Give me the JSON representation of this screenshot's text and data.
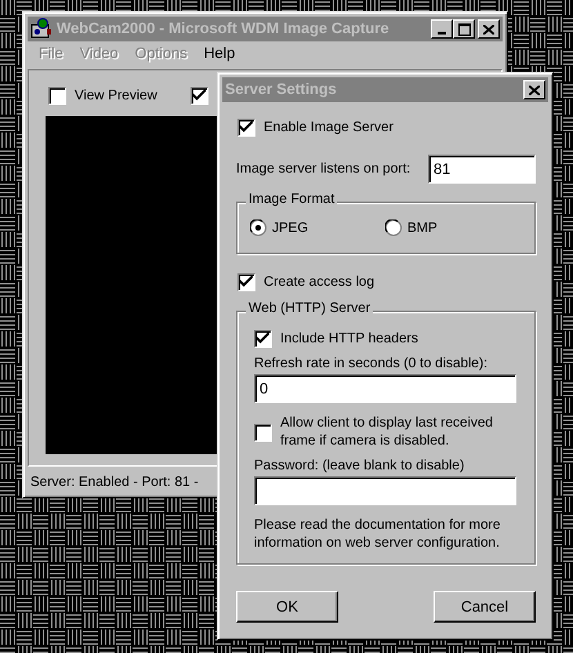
{
  "main_window": {
    "title": "WebCam2000 - Microsoft WDM Image Capture",
    "menu": [
      {
        "label": "File",
        "disabled": true
      },
      {
        "label": "Video",
        "disabled": true
      },
      {
        "label": "Options",
        "disabled": true
      },
      {
        "label": "Help",
        "disabled": false
      }
    ],
    "options": [
      {
        "label": "View Preview",
        "checked": false
      },
      {
        "checked": true
      }
    ],
    "status_bar": "Server: Enabled - Port: 81 -"
  },
  "dialog": {
    "title": "Server Settings",
    "enable_server": {
      "label": "Enable Image Server",
      "checked": true
    },
    "port": {
      "label": "Image server listens on port:",
      "value": "81"
    },
    "image_format": {
      "title": "Image Format",
      "options": [
        {
          "label": "JPEG",
          "selected": true
        },
        {
          "label": "BMP",
          "selected": false
        }
      ]
    },
    "access_log": {
      "label": "Create access log",
      "checked": true
    },
    "web_server": {
      "title": "Web (HTTP) Server",
      "include_headers": {
        "label": "Include HTTP headers",
        "checked": true
      },
      "refresh": {
        "label": "Refresh rate in seconds (0 to disable):",
        "value": "0"
      },
      "allow_last_frame": {
        "label": "Allow client to display last received frame if camera is disabled.",
        "checked": false
      },
      "password": {
        "label": "Password: (leave blank to disable)"
      },
      "note": "Please read the documentation for more information on web server configuration."
    },
    "buttons": [
      "OK",
      "Cancel"
    ]
  }
}
